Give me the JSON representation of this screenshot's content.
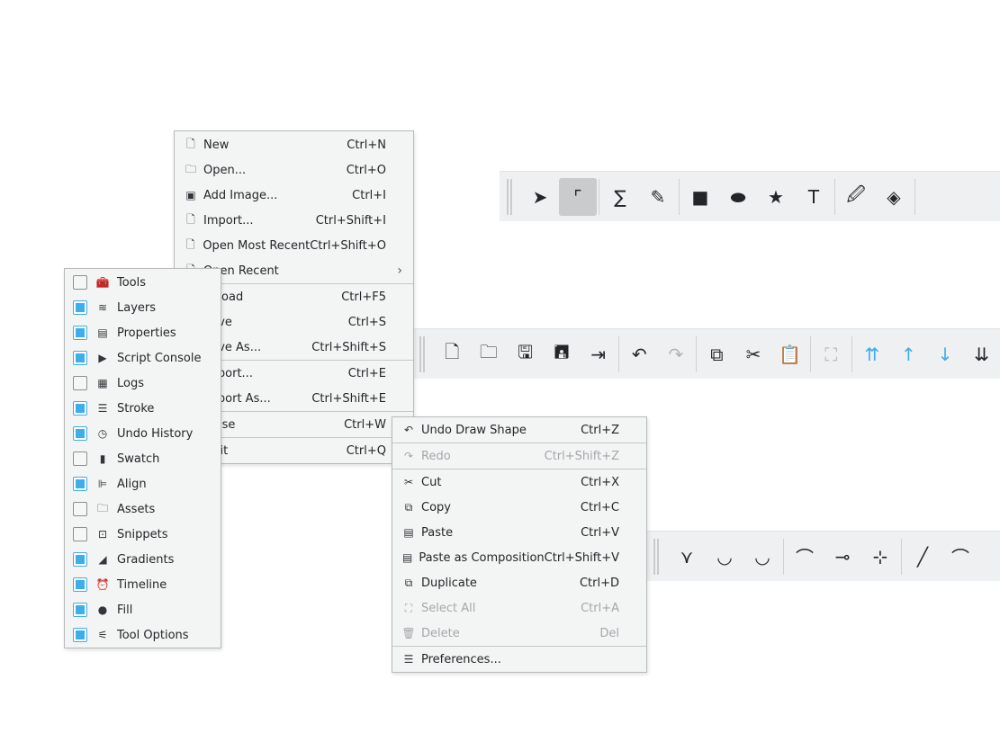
{
  "colors": {
    "accent": "#3daee9",
    "toolbar_bg": "#eff0f1",
    "menu_bg": "#f3f4f4"
  },
  "toolbar_tools": {
    "buttons": [
      {
        "icon": "select-arrow-icon",
        "glyph": "➤"
      },
      {
        "icon": "edit-path-icon",
        "glyph": "⌜",
        "active": true
      },
      "sep",
      {
        "icon": "bezier-path-icon",
        "glyph": "∑"
      },
      {
        "icon": "freehand-pencil-icon",
        "glyph": "✎"
      },
      "sep",
      {
        "icon": "rectangle-icon",
        "glyph": "■"
      },
      {
        "icon": "ellipse-icon",
        "glyph": "⬬"
      },
      {
        "icon": "star-polygon-icon",
        "glyph": "★"
      },
      {
        "icon": "text-tool-icon",
        "glyph": "T"
      },
      "sep",
      {
        "icon": "eyedropper-icon",
        "glyph": "🖉"
      },
      {
        "icon": "paint-bucket-icon",
        "glyph": "◈"
      },
      "sep"
    ]
  },
  "toolbar_main": {
    "buttons": [
      {
        "icon": "new-document-icon",
        "glyph": "🗋"
      },
      {
        "icon": "open-folder-icon",
        "glyph": "🗀"
      },
      {
        "icon": "save-icon",
        "glyph": "🖫"
      },
      {
        "icon": "save-as-icon",
        "glyph": "🖪"
      },
      {
        "icon": "export-icon",
        "glyph": "⇥"
      },
      "sep",
      {
        "icon": "undo-icon",
        "glyph": "↶"
      },
      {
        "icon": "redo-icon",
        "glyph": "↷",
        "disabled": true
      },
      "sep",
      {
        "icon": "copy-icon",
        "glyph": "⧉"
      },
      {
        "icon": "cut-icon",
        "glyph": "✂"
      },
      {
        "icon": "paste-icon",
        "glyph": "📋"
      },
      "sep",
      {
        "icon": "select-all-icon",
        "glyph": "⛶",
        "disabled": true
      },
      "sep",
      {
        "icon": "raise-to-top-icon",
        "glyph": "⇈",
        "blue": true
      },
      {
        "icon": "raise-icon",
        "glyph": "↑",
        "blue": true
      },
      {
        "icon": "lower-icon",
        "glyph": "↓",
        "blue": true
      },
      {
        "icon": "lower-to-bottom-icon",
        "glyph": "⇊"
      }
    ]
  },
  "toolbar_path": {
    "buttons": [
      {
        "icon": "node-corner-icon",
        "glyph": "⋎"
      },
      {
        "icon": "node-smooth-icon",
        "glyph": "◡"
      },
      {
        "icon": "node-symmetric-icon",
        "glyph": "◡"
      },
      "sep",
      {
        "icon": "curve-segment-icon",
        "glyph": "⌒"
      },
      {
        "icon": "remove-node-icon",
        "glyph": "⊸"
      },
      {
        "icon": "add-node-icon",
        "glyph": "⊹"
      },
      "sep",
      {
        "icon": "segment-to-line-icon",
        "glyph": "╱"
      },
      {
        "icon": "segment-to-curve-icon",
        "glyph": "⌒"
      }
    ]
  },
  "file_menu": {
    "items": [
      {
        "label": "New",
        "shortcut": "Ctrl+N",
        "icon": "new-document-icon",
        "glyph": "🗋"
      },
      {
        "label": "Open...",
        "shortcut": "Ctrl+O",
        "icon": "open-folder-icon",
        "glyph": "🗀"
      },
      {
        "label": "Add Image...",
        "shortcut": "Ctrl+I",
        "icon": "add-image-icon",
        "glyph": "▣"
      },
      {
        "label": "Import...",
        "shortcut": "Ctrl+Shift+I",
        "icon": "import-icon",
        "glyph": "🗋"
      },
      {
        "label": "Open Most Recent",
        "shortcut": "Ctrl+Shift+O",
        "icon": "open-recent-icon",
        "glyph": "🗋"
      },
      {
        "label": "Open Recent",
        "shortcut": "",
        "icon": "open-recent-icon",
        "glyph": "🗋",
        "submenu": true
      },
      "sep",
      {
        "label": "Reload",
        "shortcut": "Ctrl+F5",
        "icon": "reload-icon",
        "glyph": "⟳"
      },
      {
        "label": "Save",
        "shortcut": "Ctrl+S",
        "icon": "save-icon",
        "glyph": "🖫"
      },
      {
        "label": "Save As...",
        "shortcut": "Ctrl+Shift+S",
        "icon": "save-as-icon",
        "glyph": "🖪"
      },
      "sep",
      {
        "label": "Export...",
        "shortcut": "Ctrl+E",
        "icon": "export-icon",
        "glyph": "⇥"
      },
      {
        "label": "Export As...",
        "shortcut": "Ctrl+Shift+E",
        "icon": "export-icon",
        "glyph": "⇥"
      },
      "sep",
      {
        "label": "Close",
        "shortcut": "Ctrl+W",
        "icon": "close-icon",
        "glyph": "✕"
      },
      "sep",
      {
        "label": "Quit",
        "shortcut": "Ctrl+Q",
        "icon": "quit-icon",
        "glyph": "⏻"
      }
    ]
  },
  "edit_menu": {
    "items": [
      {
        "label": "Undo Draw Shape",
        "shortcut": "Ctrl+Z",
        "icon": "undo-icon",
        "glyph": "↶"
      },
      "sep",
      {
        "label": "Redo",
        "shortcut": "Ctrl+Shift+Z",
        "icon": "redo-icon",
        "glyph": "↷",
        "disabled": true
      },
      "sep",
      {
        "label": "Cut",
        "shortcut": "Ctrl+X",
        "icon": "cut-icon",
        "glyph": "✂"
      },
      {
        "label": "Copy",
        "shortcut": "Ctrl+C",
        "icon": "copy-icon",
        "glyph": "⧉"
      },
      {
        "label": "Paste",
        "shortcut": "Ctrl+V",
        "icon": "paste-icon",
        "glyph": "▤"
      },
      {
        "label": "Paste as Composition",
        "shortcut": "Ctrl+Shift+V",
        "icon": "paste-composition-icon",
        "glyph": "▤"
      },
      {
        "label": "Duplicate",
        "shortcut": "Ctrl+D",
        "icon": "duplicate-icon",
        "glyph": "⧉"
      },
      {
        "label": "Select All",
        "shortcut": "Ctrl+A",
        "icon": "select-all-icon",
        "glyph": "⛶",
        "disabled": true
      },
      {
        "label": "Delete",
        "shortcut": "Del",
        "icon": "delete-icon",
        "glyph": "🗑",
        "disabled": true
      },
      "sep",
      {
        "label": "Preferences...",
        "shortcut": "",
        "icon": "preferences-icon",
        "glyph": "☰"
      }
    ]
  },
  "docks_menu": {
    "items": [
      {
        "label": "Tools",
        "checked": false,
        "icon": "toolbox-icon",
        "glyph": "🧰"
      },
      {
        "label": "Layers",
        "checked": true,
        "icon": "layers-icon",
        "glyph": "≋"
      },
      {
        "label": "Properties",
        "checked": true,
        "icon": "properties-icon",
        "glyph": "▤"
      },
      {
        "label": "Script Console",
        "checked": true,
        "icon": "terminal-icon",
        "glyph": "▶"
      },
      {
        "label": "Logs",
        "checked": false,
        "icon": "logs-icon",
        "glyph": "▦"
      },
      {
        "label": "Stroke",
        "checked": true,
        "icon": "stroke-icon",
        "glyph": "☰"
      },
      {
        "label": "Undo History",
        "checked": true,
        "icon": "history-clock-icon",
        "glyph": "◷"
      },
      {
        "label": "Swatch",
        "checked": false,
        "icon": "swatch-icon",
        "glyph": "▮"
      },
      {
        "label": "Align",
        "checked": true,
        "icon": "align-icon",
        "glyph": "⊫"
      },
      {
        "label": "Assets",
        "checked": false,
        "icon": "assets-folder-icon",
        "glyph": "🗀"
      },
      {
        "label": "Snippets",
        "checked": false,
        "icon": "snippets-icon",
        "glyph": "⊡"
      },
      {
        "label": "Gradients",
        "checked": true,
        "icon": "gradient-icon",
        "glyph": "◢"
      },
      {
        "label": "Timeline",
        "checked": true,
        "icon": "timeline-alarm-icon",
        "glyph": "⏰"
      },
      {
        "label": "Fill",
        "checked": true,
        "icon": "fill-color-wheel-icon",
        "glyph": "●"
      },
      {
        "label": "Tool Options",
        "checked": true,
        "icon": "tool-options-icon",
        "glyph": "⚟"
      }
    ]
  }
}
